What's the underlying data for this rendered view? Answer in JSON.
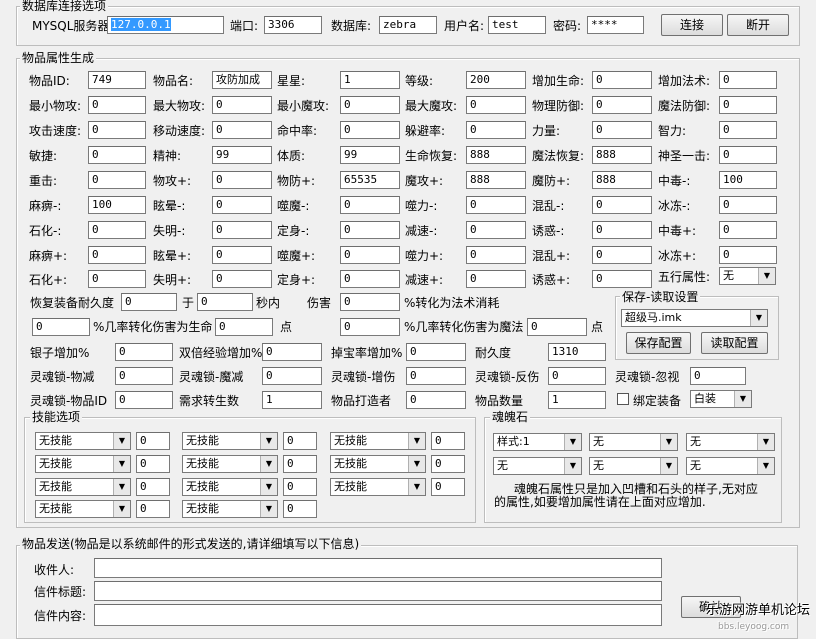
{
  "conn": {
    "legend": "数据库连接选项",
    "server_label": "MYSQL服务器:",
    "server": "127.0.0.1",
    "port_label": "端口:",
    "port": "3306",
    "db_label": "数据库:",
    "db": "zebra",
    "user_label": "用户名:",
    "user": "test",
    "pwd_label": "密码:",
    "pwd": "****",
    "connect": "连接",
    "disconnect": "断开"
  },
  "attrs": {
    "legend": "物品属性生成",
    "r1": [
      [
        "物品ID:",
        "749"
      ],
      [
        "物品名:",
        "攻防加成"
      ],
      [
        "星星:",
        "1"
      ],
      [
        "等级:",
        "200"
      ],
      [
        "增加生命:",
        "0"
      ],
      [
        "增加法术:",
        "0"
      ]
    ],
    "r2": [
      [
        "最小物攻:",
        "0"
      ],
      [
        "最大物攻:",
        "0"
      ],
      [
        "最小魔攻:",
        "0"
      ],
      [
        "最大魔攻:",
        "0"
      ],
      [
        "物理防御:",
        "0"
      ],
      [
        "魔法防御:",
        "0"
      ]
    ],
    "r3": [
      [
        "攻击速度:",
        "0"
      ],
      [
        "移动速度:",
        "0"
      ],
      [
        "命中率:",
        "0"
      ],
      [
        "躲避率:",
        "0"
      ],
      [
        "力量:",
        "0"
      ],
      [
        "智力:",
        "0"
      ]
    ],
    "r4": [
      [
        "敏捷:",
        "0"
      ],
      [
        "精神:",
        "99"
      ],
      [
        "体质:",
        "99"
      ],
      [
        "生命恢复:",
        "888"
      ],
      [
        "魔法恢复:",
        "888"
      ],
      [
        "神圣一击:",
        "0"
      ]
    ],
    "r5": [
      [
        "重击:",
        "0"
      ],
      [
        "物攻+:",
        "0"
      ],
      [
        "物防+:",
        "65535"
      ],
      [
        "魔攻+:",
        "888"
      ],
      [
        "魔防+:",
        "888"
      ],
      [
        "中毒-:",
        "100"
      ]
    ],
    "r6": [
      [
        "麻痹-:",
        "100"
      ],
      [
        "眩晕-:",
        "0"
      ],
      [
        "噬魔-:",
        "0"
      ],
      [
        "噬力-:",
        "0"
      ],
      [
        "混乱-:",
        "0"
      ],
      [
        "冰冻-:",
        "0"
      ]
    ],
    "r7": [
      [
        "石化-:",
        "0"
      ],
      [
        "失明-:",
        "0"
      ],
      [
        "定身-:",
        "0"
      ],
      [
        "减速-:",
        "0"
      ],
      [
        "诱惑-:",
        "0"
      ],
      [
        "中毒+:",
        "0"
      ]
    ],
    "r8": [
      [
        "麻痹+:",
        "0"
      ],
      [
        "眩晕+:",
        "0"
      ],
      [
        "噬魔+:",
        "0"
      ],
      [
        "噬力+:",
        "0"
      ],
      [
        "混乱+:",
        "0"
      ],
      [
        "冰冻+:",
        "0"
      ]
    ],
    "r9": [
      [
        "石化+:",
        "0"
      ],
      [
        "失明+:",
        "0"
      ],
      [
        "定身+:",
        "0"
      ],
      [
        "减速+:",
        "0"
      ],
      [
        "诱惑+:",
        "0"
      ]
    ],
    "five_label": "五行属性:",
    "five": "无",
    "repair_label": "恢复装备耐久度",
    "repair_val": "0",
    "yu": "于",
    "repair_sec": "0",
    "sec_unit": "秒内",
    "dmg_label": "伤害",
    "dmg_val": "0",
    "to_mana": "%转化为法术消耗",
    "rate_hp_val": "0",
    "rate_hp_label": "%几率转化伤害为生命",
    "rate_hp_pts": "0",
    "pts1": "点",
    "rate_mp_pre": "0",
    "rate_mp_label": "%几率转化伤害为魔法",
    "rate_mp_pts": "0",
    "pts2": "点",
    "silver_label": "银子增加%",
    "silver": "0",
    "dexp_label": "双倍经验增加%",
    "dexp": "0",
    "drop_label": "掉宝率增加%",
    "drop": "0",
    "dur_label": "耐久度",
    "dur": "1310",
    "sl1_label": "灵魂锁-物减",
    "sl1": "0",
    "sl2_label": "灵魂锁-魔减",
    "sl2": "0",
    "sl3_label": "灵魂锁-增伤",
    "sl3": "0",
    "sl4_label": "灵魂锁-反伤",
    "sl4": "0",
    "sl5_label": "灵魂锁-忽视",
    "sl5": "0",
    "slid_label": "灵魂锁-物品ID",
    "slid": "0",
    "rebirth_label": "需求转生数",
    "rebirth": "1",
    "maker_label": "物品打造者",
    "maker": "0",
    "qty_label": "物品数量",
    "qty": "1",
    "bind_label": "绑定装备",
    "quality": "白装"
  },
  "save": {
    "legend": "保存-读取设置",
    "file": "超级马.imk",
    "save": "保存配置",
    "load": "读取配置"
  },
  "skills": {
    "legend": "技能选项",
    "items": [
      [
        "无技能",
        "0"
      ],
      [
        "无技能",
        "0"
      ],
      [
        "无技能",
        "0"
      ],
      [
        "无技能",
        "0"
      ],
      [
        "无技能",
        "0"
      ],
      [
        "无技能",
        "0"
      ],
      [
        "无技能",
        "0"
      ],
      [
        "无技能",
        "0"
      ],
      [
        "无技能",
        "0"
      ],
      [
        "无技能",
        "0"
      ],
      [
        "无技能",
        "0"
      ]
    ]
  },
  "soul": {
    "legend": "魂魄石",
    "row1": [
      "样式:1",
      "无",
      "无"
    ],
    "row2": [
      "无",
      "无",
      "无"
    ],
    "note1": "魂魄石属性只是加入凹槽和石头的样子,无对应",
    "note2": "的属性,如要增加属性请在上面对应增加."
  },
  "send": {
    "legend": "物品发送(物品是以系统邮件的形式发送的,请详细填写以下信息)",
    "to_label": "收件人:",
    "to": "",
    "subj_label": "信件标题:",
    "subj": "",
    "body_label": "信件内容:",
    "body": "",
    "confirm": "确认"
  },
  "watermark": {
    "text": "乐游网游单机论坛",
    "sub": "bbs.leyoog.com"
  }
}
